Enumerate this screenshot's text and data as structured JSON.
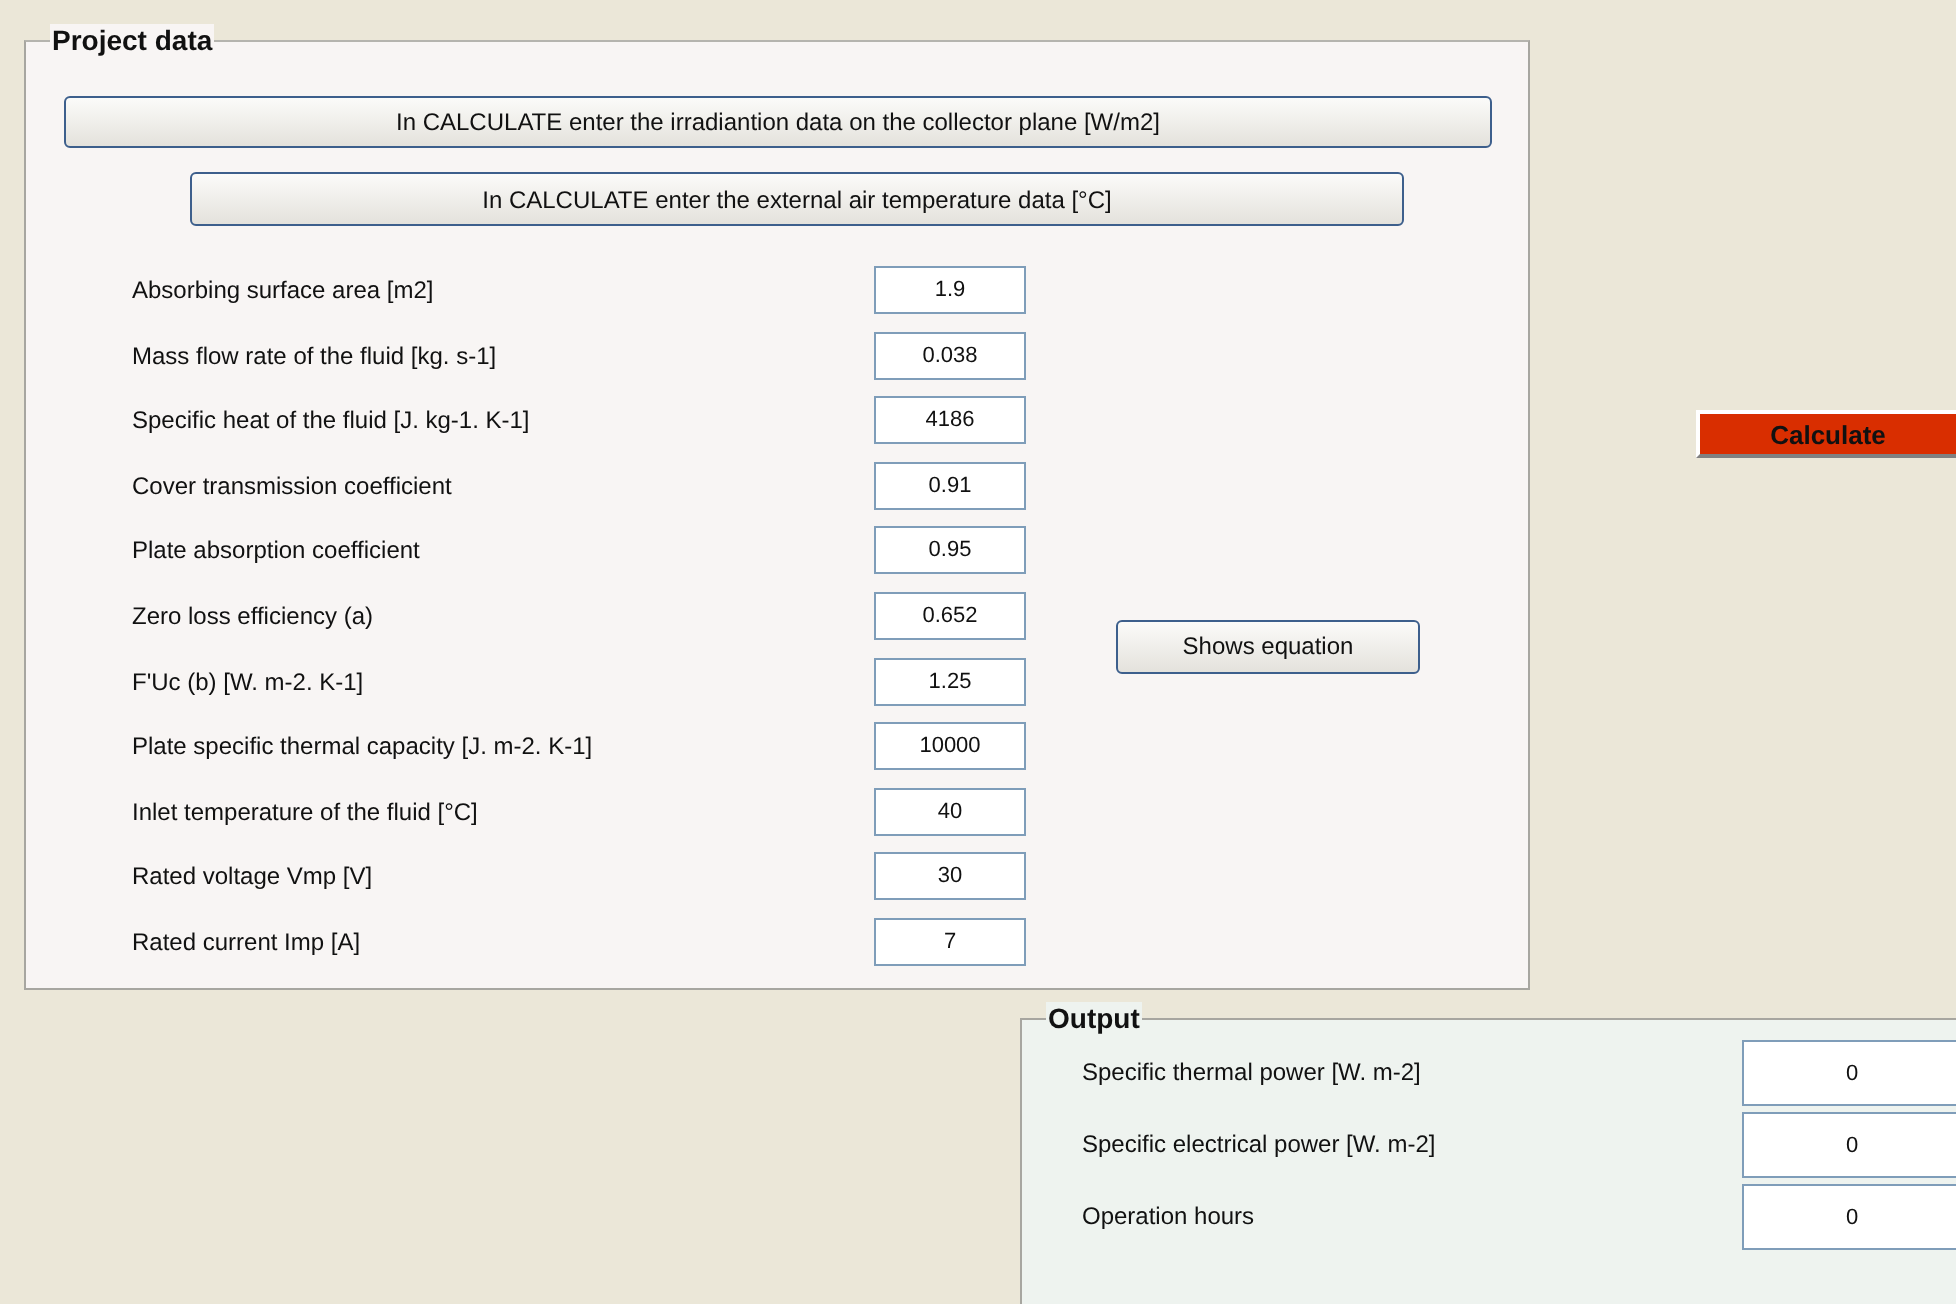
{
  "project_data": {
    "title": "Project data",
    "buttons": [
      "In CALCULATE enter the irradiantion data on the collector plane [W/m2]",
      "In CALCULATE enter the external air temperature data [°C]"
    ],
    "parameters": [
      {
        "label": "Absorbing surface area [m2]",
        "value": "1.9"
      },
      {
        "label": "Mass flow rate of the fluid [kg. s-1]",
        "value": "0.038"
      },
      {
        "label": "Specific heat of the fluid [J. kg-1. K-1]",
        "value": "4186"
      },
      {
        "label": "Cover transmission coefficient",
        "value": "0.91"
      },
      {
        "label": "Plate absorption coefficient",
        "value": "0.95"
      },
      {
        "label": "Zero loss efficiency (a)",
        "value": "0.652"
      },
      {
        "label": "F'Uc (b) [W. m-2. K-1]",
        "value": "1.25"
      },
      {
        "label": "Plate specific thermal capacity [J. m-2. K-1]",
        "value": "10000"
      },
      {
        "label": "Inlet temperature of the fluid [°C]",
        "value": "40"
      },
      {
        "label": "Rated voltage Vmp [V]",
        "value": "30"
      },
      {
        "label": "Rated current Imp [A]",
        "value": "7"
      }
    ],
    "equation_button": "Shows equation"
  },
  "calculate_button": "Calculate",
  "output": {
    "title": "Output",
    "results": [
      {
        "label": "Specific thermal power  [W. m-2]",
        "value": "0"
      },
      {
        "label": "Specific electrical power [W. m-2]",
        "value": "0"
      },
      {
        "label": "Operation hours",
        "value": "0"
      }
    ]
  }
}
